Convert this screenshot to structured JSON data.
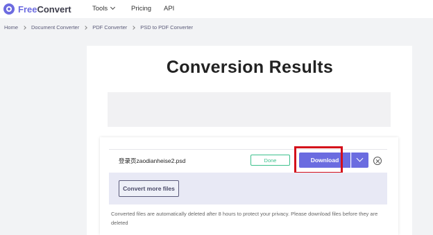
{
  "header": {
    "logo_free": "Free",
    "logo_convert": "Convert",
    "nav": {
      "tools": "Tools",
      "pricing": "Pricing",
      "api": "API"
    }
  },
  "breadcrumb": [
    "Home",
    "Document Converter",
    "PDF Converter",
    "PSD to PDF Converter"
  ],
  "main": {
    "title": "Conversion Results",
    "file": {
      "name": "登录页zaodianheise2.psd",
      "status": "Done",
      "download_label": "Download"
    },
    "convert_more_label": "Convert more files",
    "note": "Converted files are automatically deleted after 8 hours to protect your privacy. Please download files before they are deleted"
  },
  "colors": {
    "accent": "#6b6ce0",
    "done_green": "#3cc08c",
    "highlight_red": "#d40e1a"
  },
  "icons": {
    "logo": "freeconvert-logo-icon",
    "tools_chevron": "chevron-down-icon",
    "breadcrumb_separator": "chevron-right-icon",
    "download_options": "chevron-down-icon",
    "remove": "close-circle-icon"
  }
}
